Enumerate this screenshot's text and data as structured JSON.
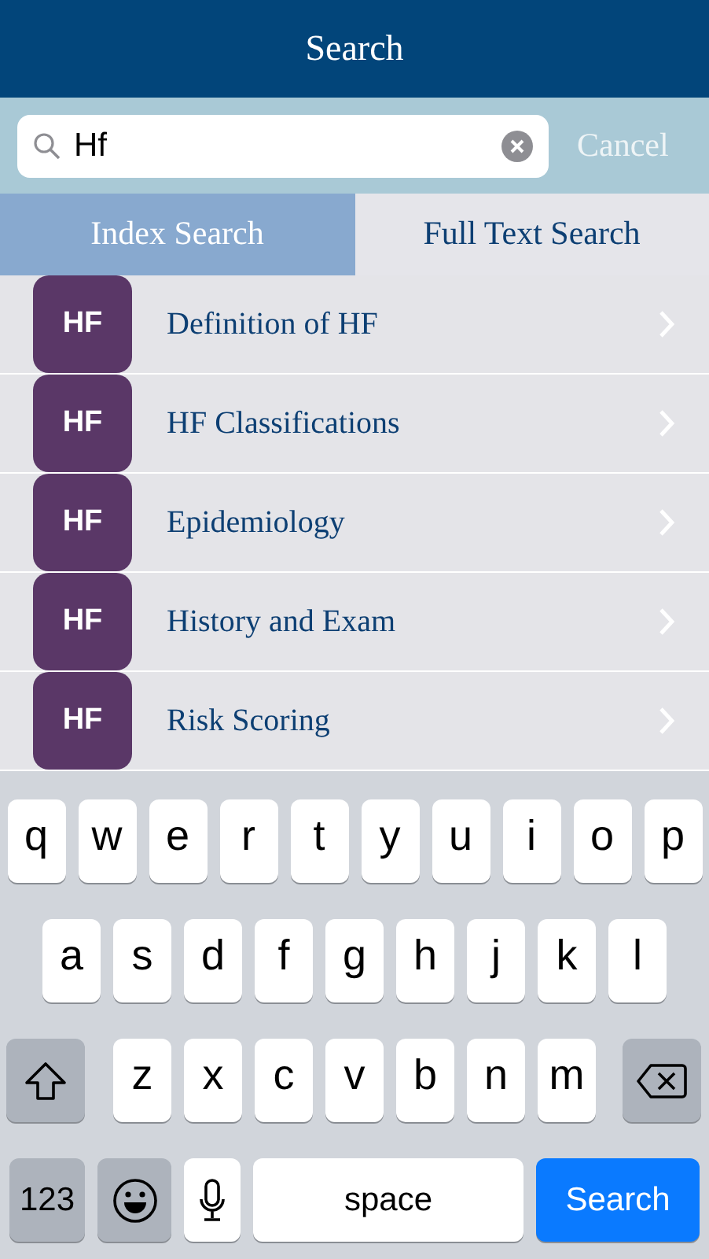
{
  "header": {
    "title": "Search"
  },
  "search": {
    "value": "Hf",
    "cancel": "Cancel"
  },
  "tabs": [
    {
      "label": "Index Search",
      "selected": true
    },
    {
      "label": "Full Text Search",
      "selected": false
    }
  ],
  "results": [
    {
      "badge": "HF",
      "title": "Definition of HF"
    },
    {
      "badge": "HF",
      "title": "HF Classifications"
    },
    {
      "badge": "HF",
      "title": "Epidemiology"
    },
    {
      "badge": "HF",
      "title": "History and Exam"
    },
    {
      "badge": "HF",
      "title": "Risk Scoring"
    }
  ],
  "keyboard": {
    "rows": [
      {
        "keys": [
          {
            "kind": "letter",
            "label": "q"
          },
          {
            "kind": "letter",
            "label": "w"
          },
          {
            "kind": "letter",
            "label": "e"
          },
          {
            "kind": "letter",
            "label": "r"
          },
          {
            "kind": "letter",
            "label": "t"
          },
          {
            "kind": "letter",
            "label": "y"
          },
          {
            "kind": "letter",
            "label": "u"
          },
          {
            "kind": "letter",
            "label": "i"
          },
          {
            "kind": "letter",
            "label": "o"
          },
          {
            "kind": "letter",
            "label": "p"
          }
        ]
      },
      {
        "keys": [
          {
            "kind": "letter",
            "label": "a"
          },
          {
            "kind": "letter",
            "label": "s"
          },
          {
            "kind": "letter",
            "label": "d"
          },
          {
            "kind": "letter",
            "label": "f"
          },
          {
            "kind": "letter",
            "label": "g"
          },
          {
            "kind": "letter",
            "label": "h"
          },
          {
            "kind": "letter",
            "label": "j"
          },
          {
            "kind": "letter",
            "label": "k"
          },
          {
            "kind": "letter",
            "label": "l"
          }
        ]
      },
      {
        "keys": [
          {
            "kind": "shift"
          },
          {
            "kind": "letter",
            "label": "z"
          },
          {
            "kind": "letter",
            "label": "x"
          },
          {
            "kind": "letter",
            "label": "c"
          },
          {
            "kind": "letter",
            "label": "v"
          },
          {
            "kind": "letter",
            "label": "b"
          },
          {
            "kind": "letter",
            "label": "n"
          },
          {
            "kind": "letter",
            "label": "m"
          },
          {
            "kind": "backspace"
          }
        ]
      },
      {
        "keys": [
          {
            "kind": "numbers",
            "label": "123"
          },
          {
            "kind": "emoji"
          },
          {
            "kind": "mic"
          },
          {
            "kind": "space",
            "label": "space"
          },
          {
            "kind": "action",
            "label": "Search"
          }
        ]
      }
    ]
  }
}
